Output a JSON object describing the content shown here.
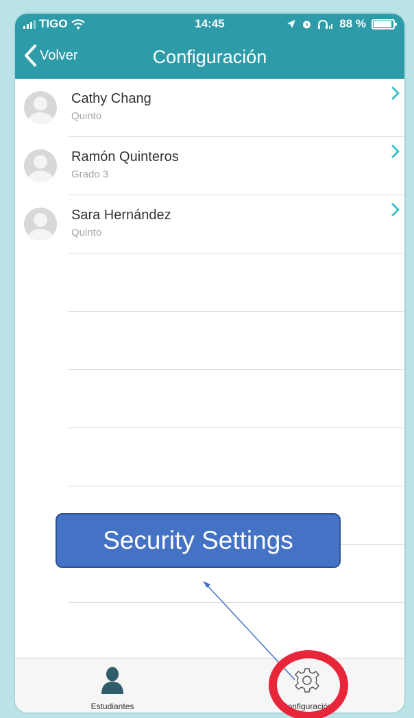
{
  "status_bar": {
    "carrier": "TIGO",
    "time": "14:45",
    "battery": "88 %"
  },
  "nav": {
    "back_label": "Volver",
    "title": "Configuración"
  },
  "students": [
    {
      "name": "Cathy Chang",
      "grade": "Quinto"
    },
    {
      "name": "Ramón Quinteros",
      "grade": "Grado 3"
    },
    {
      "name": "Sara Hernández",
      "grade": "Quinto"
    }
  ],
  "tab_bar": {
    "students_label": "Estudiantes",
    "settings_label": "Configuración"
  },
  "annotation": {
    "callout_text": "Security Settings",
    "callout_color": "#4472c4",
    "highlight_color": "#e8263a"
  },
  "colors": {
    "accent": "#2e9ba8",
    "chevron": "#3cc0cc"
  }
}
